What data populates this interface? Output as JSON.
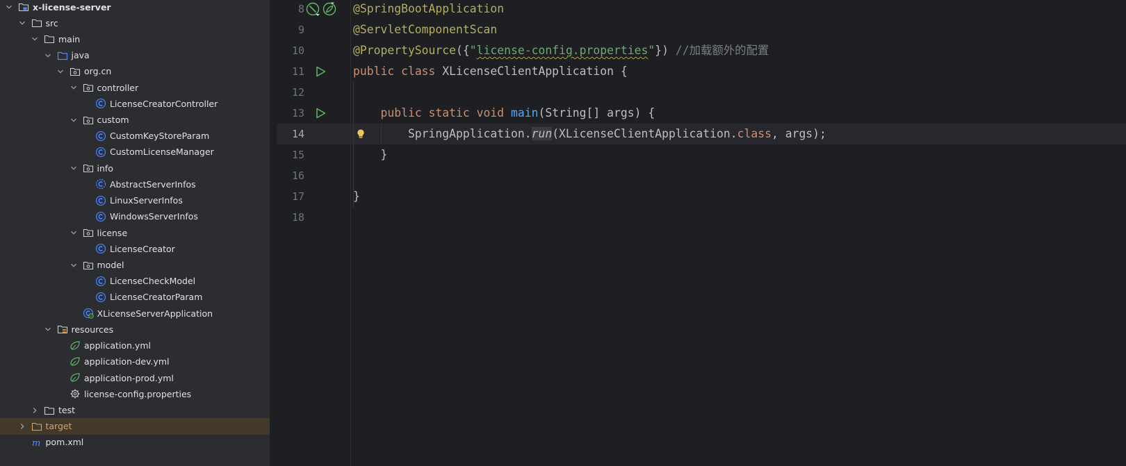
{
  "project_tree": {
    "items": [
      {
        "label": "x-license-server",
        "depth": 0,
        "arrow": "down",
        "icon": "module-folder-icon",
        "bold": true
      },
      {
        "label": "src",
        "depth": 1,
        "arrow": "down",
        "icon": "folder-icon"
      },
      {
        "label": "main",
        "depth": 2,
        "arrow": "down",
        "icon": "folder-icon"
      },
      {
        "label": "java",
        "depth": 3,
        "arrow": "down",
        "icon": "source-folder-icon"
      },
      {
        "label": "org.cn",
        "depth": 4,
        "arrow": "down",
        "icon": "package-icon"
      },
      {
        "label": "controller",
        "depth": 5,
        "arrow": "down",
        "icon": "package-icon"
      },
      {
        "label": "LicenseCreatorController",
        "depth": 6,
        "arrow": "none",
        "icon": "class-icon"
      },
      {
        "label": "custom",
        "depth": 5,
        "arrow": "down",
        "icon": "package-icon"
      },
      {
        "label": "CustomKeyStoreParam",
        "depth": 6,
        "arrow": "none",
        "icon": "class-icon"
      },
      {
        "label": "CustomLicenseManager",
        "depth": 6,
        "arrow": "none",
        "icon": "class-icon"
      },
      {
        "label": "info",
        "depth": 5,
        "arrow": "down",
        "icon": "package-icon"
      },
      {
        "label": "AbstractServerInfos",
        "depth": 6,
        "arrow": "none",
        "icon": "abstract-class-icon"
      },
      {
        "label": "LinuxServerInfos",
        "depth": 6,
        "arrow": "none",
        "icon": "class-icon"
      },
      {
        "label": "WindowsServerInfos",
        "depth": 6,
        "arrow": "none",
        "icon": "class-icon"
      },
      {
        "label": "license",
        "depth": 5,
        "arrow": "down",
        "icon": "package-icon"
      },
      {
        "label": "LicenseCreator",
        "depth": 6,
        "arrow": "none",
        "icon": "class-icon"
      },
      {
        "label": "model",
        "depth": 5,
        "arrow": "down",
        "icon": "package-icon"
      },
      {
        "label": "LicenseCheckModel",
        "depth": 6,
        "arrow": "none",
        "icon": "class-icon"
      },
      {
        "label": "LicenseCreatorParam",
        "depth": 6,
        "arrow": "none",
        "icon": "class-icon"
      },
      {
        "label": "XLicenseServerApplication",
        "depth": 5,
        "arrow": "none",
        "icon": "spring-boot-class-icon"
      },
      {
        "label": "resources",
        "depth": 3,
        "arrow": "down",
        "icon": "resources-folder-icon"
      },
      {
        "label": "application.yml",
        "depth": 4,
        "arrow": "none",
        "icon": "spring-yml-icon"
      },
      {
        "label": "application-dev.yml",
        "depth": 4,
        "arrow": "none",
        "icon": "spring-yml-icon"
      },
      {
        "label": "application-prod.yml",
        "depth": 4,
        "arrow": "none",
        "icon": "spring-yml-icon"
      },
      {
        "label": "license-config.properties",
        "depth": 4,
        "arrow": "none",
        "icon": "properties-gear-icon"
      },
      {
        "label": "test",
        "depth": 2,
        "arrow": "right",
        "icon": "folder-icon"
      },
      {
        "label": "target",
        "depth": 1,
        "arrow": "right",
        "icon": "excluded-folder-icon",
        "orange": true,
        "selected": true
      },
      {
        "label": "pom.xml",
        "depth": 1,
        "arrow": "none",
        "icon": "maven-icon"
      }
    ]
  },
  "editor": {
    "current_line": "14",
    "lines": [
      {
        "num": "8",
        "gutter": [
          "spring-bean-icon",
          "spring-config-icon"
        ],
        "tokens": [
          {
            "t": "@SpringBootApplication",
            "c": "ann"
          }
        ]
      },
      {
        "num": "9",
        "gutter": [],
        "tokens": [
          {
            "t": "@ServletComponentScan",
            "c": "ann"
          }
        ]
      },
      {
        "num": "10",
        "gutter": [],
        "tokens": [
          {
            "t": "@PropertySource",
            "c": "ann"
          },
          {
            "t": "({",
            "c": ""
          },
          {
            "t": "\"",
            "c": "str"
          },
          {
            "t": "license-config.properties",
            "c": "str squig"
          },
          {
            "t": "\"",
            "c": "str"
          },
          {
            "t": "}) ",
            "c": ""
          },
          {
            "t": "//加载额外的配置",
            "c": "cm"
          }
        ]
      },
      {
        "num": "11",
        "gutter": [
          "run-icon"
        ],
        "tokens": [
          {
            "t": "public ",
            "c": "kw"
          },
          {
            "t": "class ",
            "c": "kw"
          },
          {
            "t": "XLicenseClientApplication {",
            "c": ""
          }
        ]
      },
      {
        "num": "12",
        "gutter": [],
        "tokens": []
      },
      {
        "num": "13",
        "gutter": [
          "run-icon"
        ],
        "tokens": [
          {
            "t": "    ",
            "c": ""
          },
          {
            "t": "public ",
            "c": "kw"
          },
          {
            "t": "static ",
            "c": "kw"
          },
          {
            "t": "void ",
            "c": "kw"
          },
          {
            "t": "main",
            "c": "fn"
          },
          {
            "t": "(String[] args) {",
            "c": ""
          }
        ]
      },
      {
        "num": "14",
        "gutter": [
          "bulb-icon"
        ],
        "tokens": [
          {
            "t": "        SpringApplication.",
            "c": ""
          },
          {
            "t": "run",
            "c": "it runhl"
          },
          {
            "t": "(XLicenseClientApplication.",
            "c": ""
          },
          {
            "t": "class",
            "c": "kw"
          },
          {
            "t": ", args);",
            "c": ""
          }
        ]
      },
      {
        "num": "15",
        "gutter": [],
        "tokens": [
          {
            "t": "    }",
            "c": ""
          }
        ]
      },
      {
        "num": "16",
        "gutter": [],
        "tokens": []
      },
      {
        "num": "17",
        "gutter": [],
        "tokens": [
          {
            "t": "}",
            "c": ""
          }
        ]
      },
      {
        "num": "18",
        "gutter": [],
        "tokens": []
      }
    ]
  },
  "colors": {
    "annotation": "#b3ae60",
    "keyword": "#cf8e6d",
    "string": "#6aab73",
    "function": "#56a8f5",
    "comment": "#7a7e85",
    "class_icon": "#548af7",
    "spring_green": "#5fb865"
  }
}
